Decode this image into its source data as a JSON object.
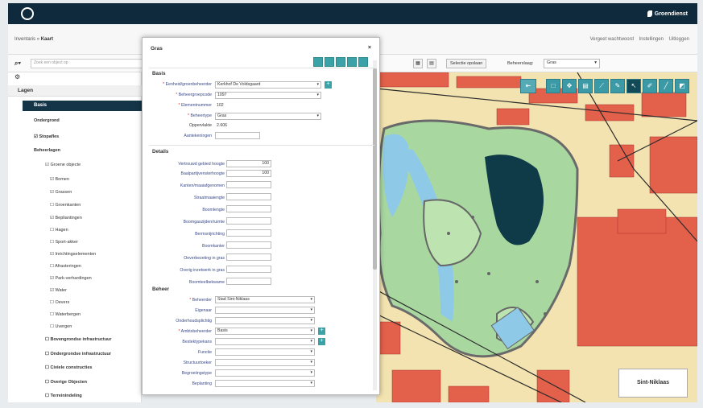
{
  "header": {
    "brand": "Groendienst"
  },
  "breadcrumb": {
    "root": "Inventaris",
    "sep": "»",
    "current": "Kaart"
  },
  "top_links": [
    "Vergeet wachtwoord",
    "Instellingen",
    "Uitloggen"
  ],
  "toolbar": {
    "search_placeholder": "Zoek een object op",
    "btn_select": "Selectie opslaan",
    "beheerslaag_label": "Beheerslaag:",
    "beheerslaag_value": "Gras"
  },
  "sidebar": {
    "title": "Lagen",
    "items": [
      {
        "label": "Basis",
        "active": true
      },
      {
        "label": "Ondergrond",
        "bold": true
      },
      {
        "label": "Stopafles",
        "bold": true,
        "check": true
      },
      {
        "label": "Beheerlagen",
        "bold": true
      },
      {
        "label": "Groene objecte",
        "check": true
      },
      {
        "label": "Bomen",
        "check": true
      },
      {
        "label": "Grassen",
        "check": true
      },
      {
        "label": "Groenkanten"
      },
      {
        "label": "Bepliantingen",
        "check": true
      },
      {
        "label": "Hagen"
      },
      {
        "label": "Sport-akker"
      },
      {
        "label": "Inrichtingselementen",
        "check": true
      },
      {
        "label": "Afrasteringen"
      },
      {
        "label": "Park-verhardingen",
        "check": true
      },
      {
        "label": "Water",
        "check": true
      },
      {
        "label": "Oevers"
      },
      {
        "label": "Waterbergen"
      },
      {
        "label": "Uvergen"
      },
      {
        "label": "Bovengrondse infrastructuur",
        "bold": true
      },
      {
        "label": "Ondergrondse infrastructuur",
        "bold": true
      },
      {
        "label": "Civiele constructies",
        "bold": true
      },
      {
        "label": "Overige Objecten",
        "bold": true
      },
      {
        "label": "Terreinindeling",
        "bold": true
      }
    ]
  },
  "dialog": {
    "title": "Gras",
    "close": "×",
    "basis": {
      "heading": "Basis",
      "fields": [
        {
          "label": "Eenheid/groenbeheerder",
          "value": "Kerkhof De Voldsgaard",
          "type": "select",
          "req": true,
          "plus": true
        },
        {
          "label": "Beheergroepcode",
          "value": "1097",
          "type": "select",
          "req": true
        },
        {
          "label": "Elementnummer",
          "value": "102",
          "type": "text",
          "req": true
        },
        {
          "label": "Beheertype",
          "value": "Gras",
          "type": "select",
          "req": true
        },
        {
          "label": "Oppervlakte",
          "value": "2.606",
          "type": "ro"
        },
        {
          "label": "Aantekeningen",
          "value": "",
          "type": "text"
        }
      ]
    },
    "details": {
      "heading": "Details",
      "fields": [
        {
          "label": "Vertrouwd gebied hoogte",
          "value": "100"
        },
        {
          "label": "Baalpartijvensterhoogte",
          "value": "100"
        },
        {
          "label": "Kanten/maaiafgenomen",
          "value": ""
        },
        {
          "label": "Straatmaaiengte",
          "value": ""
        },
        {
          "label": "Boomlengte",
          "value": ""
        },
        {
          "label": "Boomgaszijden/ruimte",
          "value": ""
        },
        {
          "label": "Bermsnijrichting",
          "value": ""
        },
        {
          "label": "Boomkanter",
          "value": ""
        },
        {
          "label": "Oeverbezeting in gras",
          "value": ""
        },
        {
          "label": "Overig inzetwerk in gras",
          "value": ""
        },
        {
          "label": "Boomteelbekwame",
          "value": ""
        }
      ]
    },
    "beheer": {
      "heading": "Beheer",
      "fields": [
        {
          "label": "Beheerder",
          "value": "Stad Sint-Niklaas",
          "req": true
        },
        {
          "label": "Eigenaar",
          "value": ""
        },
        {
          "label": "Onderhoudsplichtig",
          "value": ""
        },
        {
          "label": "Ambtsbeheerder",
          "value": "Basis",
          "req": true,
          "plus": true
        },
        {
          "label": "Bestektypekans",
          "value": "",
          "plus": true
        },
        {
          "label": "Functie",
          "value": ""
        },
        {
          "label": "Structuurtoeker",
          "value": ""
        },
        {
          "label": "Begroeiingstype",
          "value": ""
        },
        {
          "label": "Beplanting",
          "value": ""
        }
      ]
    }
  },
  "map": {
    "overview_label": "Sint-Niklaas"
  }
}
